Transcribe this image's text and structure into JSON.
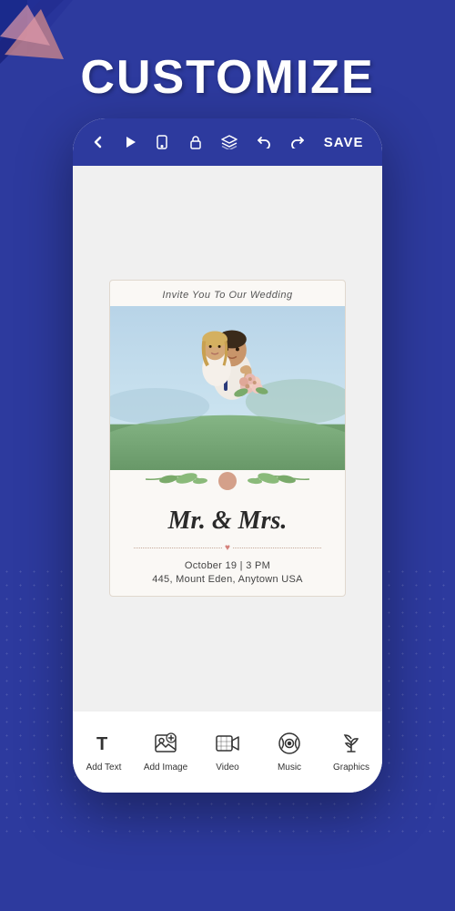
{
  "page": {
    "title": "CUSTOMIZE"
  },
  "toolbar": {
    "back_label": "‹",
    "play_label": "▶",
    "device_label": "☐",
    "lock_label": "🔓",
    "layers_label": "⊕",
    "undo_label": "↩",
    "redo_label": "↪",
    "save_label": "SAVE"
  },
  "wedding_card": {
    "header_text": "Invite You To Our Wedding",
    "title": "Mr. & Mrs.",
    "date": "October 19 | 3 PM",
    "venue": "445, Mount Eden, Anytown USA"
  },
  "tab_bar": {
    "items": [
      {
        "id": "add-text",
        "icon": "T",
        "label": "Add Text"
      },
      {
        "id": "add-image",
        "icon": "IMG",
        "label": "Add Image"
      },
      {
        "id": "video",
        "icon": "VID",
        "label": "Video"
      },
      {
        "id": "music",
        "icon": "MUS",
        "label": "Music"
      },
      {
        "id": "graphics",
        "icon": "GFX",
        "label": "Graphics"
      }
    ]
  },
  "colors": {
    "brand_blue": "#2d3a9e",
    "dark_blue": "#1a237e",
    "accent_pink": "#e8a0b0",
    "text_dark": "#2a2a2a",
    "text_muted": "#555555",
    "heart_red": "#d4807a",
    "divider_tan": "#c4a898"
  }
}
